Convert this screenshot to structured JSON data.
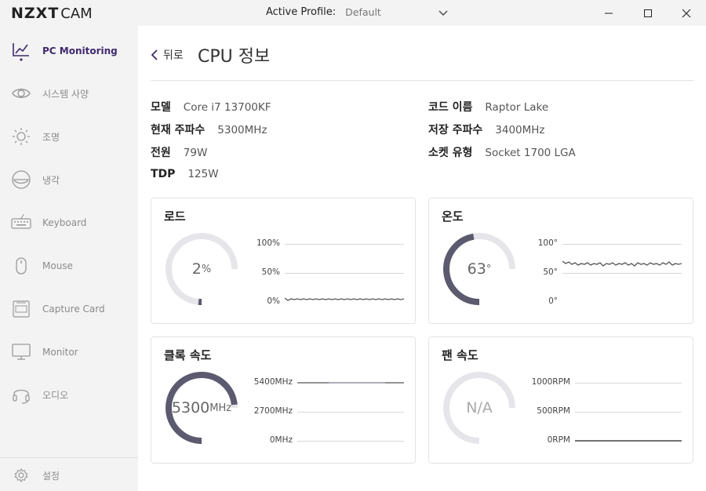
{
  "titlebar": {
    "logo_brand": "NZXT",
    "logo_app": "CAM",
    "profile_label": "Active Profile:",
    "profile_value": "Default"
  },
  "sidebar": {
    "items": [
      {
        "label": "PC Monitoring",
        "icon": "line-chart-icon",
        "active": true
      },
      {
        "label": "시스템 사양",
        "icon": "eye-icon"
      },
      {
        "label": "조명",
        "icon": "sun-icon"
      },
      {
        "label": "냉각",
        "icon": "cooler-icon"
      },
      {
        "label": "Keyboard",
        "icon": "keyboard-icon"
      },
      {
        "label": "Mouse",
        "icon": "mouse-icon"
      },
      {
        "label": "Capture Card",
        "icon": "capture-card-icon"
      },
      {
        "label": "Monitor",
        "icon": "monitor-icon"
      },
      {
        "label": "오디오",
        "icon": "headset-icon"
      }
    ],
    "settings_label": "설정"
  },
  "main": {
    "back_label": "뒤로",
    "title": "CPU 정보",
    "specs_left": [
      {
        "key": "모델",
        "value": "Core i7 13700KF"
      },
      {
        "key": "현재 주파수",
        "value": "5300MHz"
      },
      {
        "key": "전원",
        "value": "79W"
      },
      {
        "key": "TDP",
        "value": "125W"
      }
    ],
    "specs_right": [
      {
        "key": "코드 이름",
        "value": "Raptor Lake"
      },
      {
        "key": "저장 주파수",
        "value": "3400MHz"
      },
      {
        "key": "소켓 유형",
        "value": "Socket 1700 LGA"
      }
    ]
  },
  "cards": {
    "load": {
      "title": "로드",
      "value": "2",
      "unit": "%",
      "fraction": 0.02,
      "axis": [
        "100%",
        "50%",
        "0%"
      ]
    },
    "temp": {
      "title": "온도",
      "value": "63",
      "unit": "°",
      "fraction": 0.63,
      "axis": [
        "100°",
        "50°",
        "0°"
      ]
    },
    "clock": {
      "title": "클록 속도",
      "value": "5300",
      "unit": "MHz",
      "fraction": 0.98,
      "axis": [
        "5400MHz",
        "2700MHz",
        "0MHz"
      ]
    },
    "fan": {
      "title": "팬 속도",
      "value": "N/A",
      "unit": "",
      "fraction": 0,
      "axis": [
        "1000RPM",
        "500RPM",
        "0RPM"
      ]
    }
  },
  "colors": {
    "accent": "#3f2a6d",
    "gauge_track": "#e6e6ea",
    "gauge_fill": "#5c5a6e",
    "sidebar_bg": "#f3f3f3"
  }
}
